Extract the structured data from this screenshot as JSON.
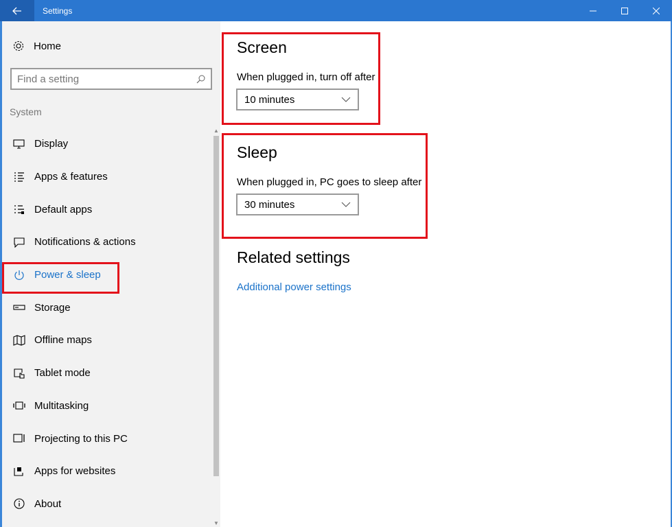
{
  "window": {
    "title": "Settings"
  },
  "sidebar": {
    "home_label": "Home",
    "search_placeholder": "Find a setting",
    "section_label": "System",
    "items": [
      {
        "label": "Display",
        "icon": "monitor-icon"
      },
      {
        "label": "Apps & features",
        "icon": "list-icon"
      },
      {
        "label": "Default apps",
        "icon": "default-apps-icon"
      },
      {
        "label": "Notifications & actions",
        "icon": "notification-icon"
      },
      {
        "label": "Power & sleep",
        "icon": "power-icon",
        "active": true
      },
      {
        "label": "Storage",
        "icon": "storage-icon"
      },
      {
        "label": "Offline maps",
        "icon": "map-icon"
      },
      {
        "label": "Tablet mode",
        "icon": "tablet-mode-icon"
      },
      {
        "label": "Multitasking",
        "icon": "multitasking-icon"
      },
      {
        "label": "Projecting to this PC",
        "icon": "projecting-icon"
      },
      {
        "label": "Apps for websites",
        "icon": "apps-websites-icon"
      },
      {
        "label": "About",
        "icon": "info-icon"
      }
    ]
  },
  "main": {
    "screen": {
      "title": "Screen",
      "subtitle": "When plugged in, turn off after",
      "value": "10 minutes"
    },
    "sleep": {
      "title": "Sleep",
      "subtitle": "When plugged in, PC goes to sleep after",
      "value": "30 minutes"
    },
    "related": {
      "title": "Related settings",
      "link": "Additional power settings"
    }
  },
  "colors": {
    "titlebar": "#2b77d0",
    "accent": "#1a72c9",
    "highlight": "#e3121b",
    "sidebar_bg": "#f2f2f2"
  }
}
